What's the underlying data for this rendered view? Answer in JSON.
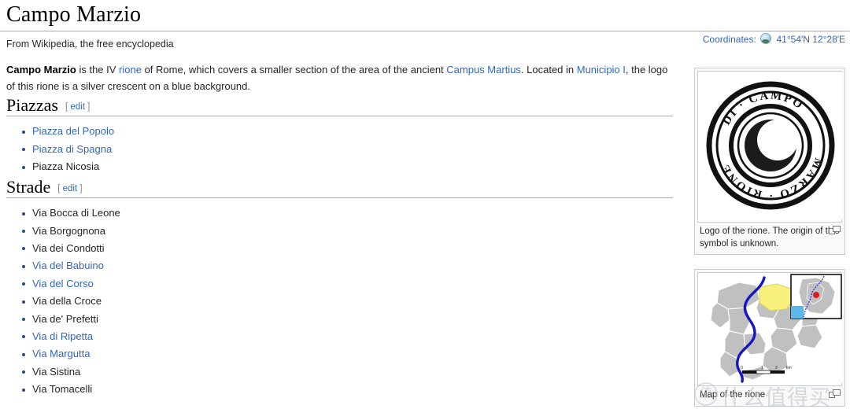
{
  "page": {
    "title": "Campo Marzio",
    "tagline": "From Wikipedia, the free encyclopedia"
  },
  "coordinates": {
    "label": "Coordinates:",
    "globe_icon": "globe-icon",
    "value": "41°54′N 12°28′E"
  },
  "lead": {
    "bold_title": "Campo Marzio",
    "t1": " is the IV ",
    "link_rione": "rione",
    "t2": " of Rome, which covers a smaller section of the area of the ancient ",
    "link_campus": "Campus Martius",
    "t3": ". Located in ",
    "link_municipio": "Municipio I",
    "t4": ", the logo of this rione is a silver crescent on a blue background."
  },
  "sections": [
    {
      "heading": "Piazzas",
      "edit_open": "[",
      "edit_label": "edit",
      "edit_close": "]",
      "items": [
        {
          "label": "Piazza del Popolo",
          "link": true
        },
        {
          "label": "Piazza di Spagna",
          "link": true
        },
        {
          "label": "Piazza Nicosia",
          "link": false
        }
      ]
    },
    {
      "heading": "Strade",
      "edit_open": "[",
      "edit_label": "edit",
      "edit_close": "]",
      "items": [
        {
          "label": "Via Bocca di Leone",
          "link": false
        },
        {
          "label": "Via Borgognona",
          "link": false
        },
        {
          "label": "Via dei Condotti",
          "link": false
        },
        {
          "label": "Via del Babuino",
          "link": true
        },
        {
          "label": "Via del Corso",
          "link": true
        },
        {
          "label": "Via della Croce",
          "link": false
        },
        {
          "label": "Via de' Prefetti",
          "link": false
        },
        {
          "label": "Via di Ripetta",
          "link": true
        },
        {
          "label": "Via Margutta",
          "link": true
        },
        {
          "label": "Via Sistina",
          "link": false
        },
        {
          "label": "Via Tomacelli",
          "link": false
        }
      ]
    }
  ],
  "thumbs": {
    "logo": {
      "caption": "Logo of the rione. The origin of this symbol is unknown.",
      "magnify_icon": "enlarge-icon",
      "seal_text_top": "DI · CAMPO",
      "seal_text_left": "RIONE",
      "seal_text_right": "MARZO"
    },
    "map": {
      "caption": "Map of the rione",
      "magnify_icon": "enlarge-icon",
      "scale_labels": [
        "0",
        "1",
        "2",
        "km"
      ]
    }
  },
  "watermark": {
    "mark": "值",
    "text": "什么值得买"
  },
  "colors": {
    "link": "#3366bb",
    "text": "#252525",
    "rule": "#a2a9b1",
    "highlight": "#f7f07a",
    "river": "#1414cd",
    "land": "#c0c0c0"
  }
}
